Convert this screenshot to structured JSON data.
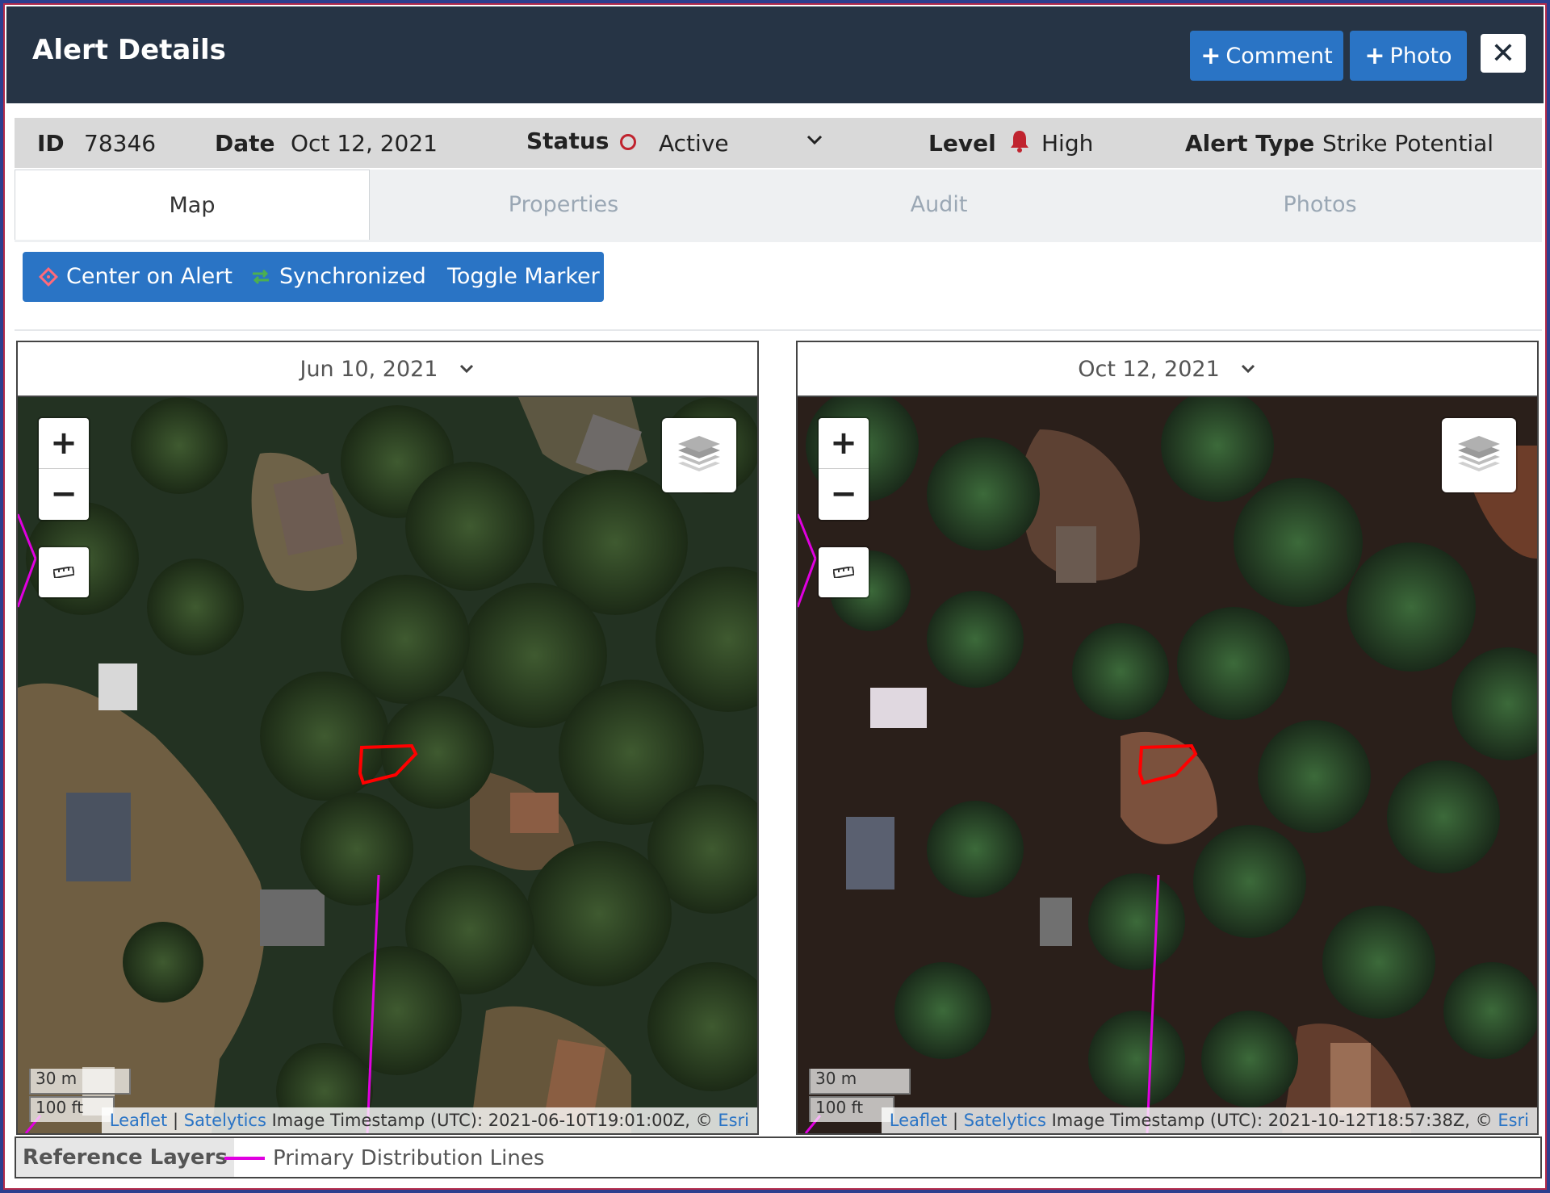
{
  "header": {
    "title": "Alert Details",
    "comment_label": "Comment",
    "photo_label": "Photo",
    "close_glyph": "✕"
  },
  "info": {
    "id_label": "ID",
    "id_value": "78346",
    "date_label": "Date",
    "date_value": "Oct 12, 2021",
    "status_label": "Status",
    "status_value": "Active",
    "level_label": "Level",
    "level_value": "High",
    "type_label": "Alert Type",
    "type_value": "Strike Potential"
  },
  "tabs": [
    {
      "label": "Map",
      "active": true
    },
    {
      "label": "Properties",
      "active": false
    },
    {
      "label": "Audit",
      "active": false
    },
    {
      "label": "Photos",
      "active": false
    }
  ],
  "toolbar": {
    "center_label": "Center on Alert",
    "sync_label": "Synchronized",
    "toggle_label": "Toggle Marker"
  },
  "maps": {
    "left": {
      "date": "Jun 10, 2021",
      "scale_m": "30 m",
      "scale_ft": "100 ft",
      "attrib_leaflet": "Leaflet",
      "attrib_sep": "|",
      "attrib_satelytics": "Satelytics",
      "attrib_text": "Image Timestamp (UTC): 2021-06-10T19:01:00Z, ©",
      "attrib_esri": "Esri"
    },
    "right": {
      "date": "Oct 12, 2021",
      "scale_m": "30 m",
      "scale_ft": "100 ft",
      "attrib_leaflet": "Leaflet",
      "attrib_sep": "|",
      "attrib_satelytics": "Satelytics",
      "attrib_text": "Image Timestamp (UTC): 2021-10-12T18:57:38Z, ©",
      "attrib_esri": "Esri"
    }
  },
  "footer": {
    "reference_label": "Reference Layers",
    "layer_label": "Primary Distribution Lines"
  },
  "colors": {
    "header_bg": "#263445",
    "accent": "#2a74c5",
    "alert_red": "#c0242f",
    "distribution_line": "#e000e0"
  },
  "icons": [
    "plus-icon",
    "close-icon",
    "status-circle-icon",
    "chevron-down-icon",
    "bell-icon",
    "crosshair-icon",
    "sync-icon",
    "zoom-in-icon",
    "zoom-out-icon",
    "ruler-icon",
    "layers-icon"
  ]
}
